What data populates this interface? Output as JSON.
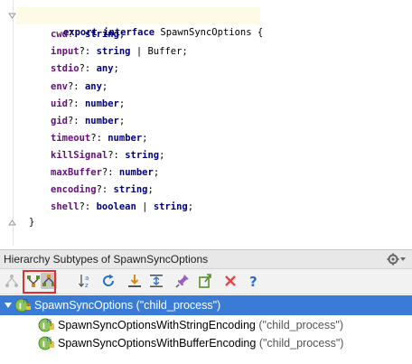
{
  "editor": {
    "lines": [
      {
        "kw": "export interface ",
        "name": "SpawnSyncOptions",
        "tail": " {"
      },
      {
        "prop": "cwd",
        "sep": "?: ",
        "type": "string",
        "tail": ";"
      },
      {
        "prop": "input",
        "sep": "?: ",
        "type": "string",
        "mid": " | ",
        "type2": "Buffer",
        "tail": ";"
      },
      {
        "prop": "stdio",
        "sep": "?: ",
        "type": "any",
        "tail": ";"
      },
      {
        "prop": "env",
        "sep": "?: ",
        "type": "any",
        "tail": ";"
      },
      {
        "prop": "uid",
        "sep": "?: ",
        "type": "number",
        "tail": ";"
      },
      {
        "prop": "gid",
        "sep": "?: ",
        "type": "number",
        "tail": ";"
      },
      {
        "prop": "timeout",
        "sep": "?: ",
        "type": "number",
        "tail": ";"
      },
      {
        "prop": "killSignal",
        "sep": "?: ",
        "type": "string",
        "tail": ";"
      },
      {
        "prop": "maxBuffer",
        "sep": "?: ",
        "type": "number",
        "tail": ";"
      },
      {
        "prop": "encoding",
        "sep": "?: ",
        "type": "string",
        "tail": ";"
      },
      {
        "prop": "shell",
        "sep": "?: ",
        "type": "boolean",
        "mid": " | ",
        "type2b": "string",
        "tail": ";"
      },
      {
        "close": "}"
      }
    ]
  },
  "panel": {
    "title": "Hierarchy Subtypes of SpawnSyncOptions"
  },
  "toolbar": {
    "icons": [
      "type-hierarchy-icon",
      "supertypes-icon",
      "subtypes-icon",
      "sort-alpha-icon",
      "refresh-icon",
      "export-icon",
      "scroll-from-source-icon",
      "pin-icon",
      "open-external-icon",
      "close-icon",
      "help-icon"
    ]
  },
  "tree": {
    "root": {
      "name": "SpawnSyncOptions",
      "pkg": " (\"child_process\")"
    },
    "children": [
      {
        "name": "SpawnSyncOptionsWithStringEncoding",
        "pkg": " (\"child_process\")"
      },
      {
        "name": "SpawnSyncOptionsWithBufferEncoding",
        "pkg": " (\"child_process\")"
      }
    ]
  },
  "colors": {
    "selection": "#3a7bd5",
    "highlight_box": "#e03030",
    "keyword": "#000080",
    "property": "#660e7a"
  }
}
